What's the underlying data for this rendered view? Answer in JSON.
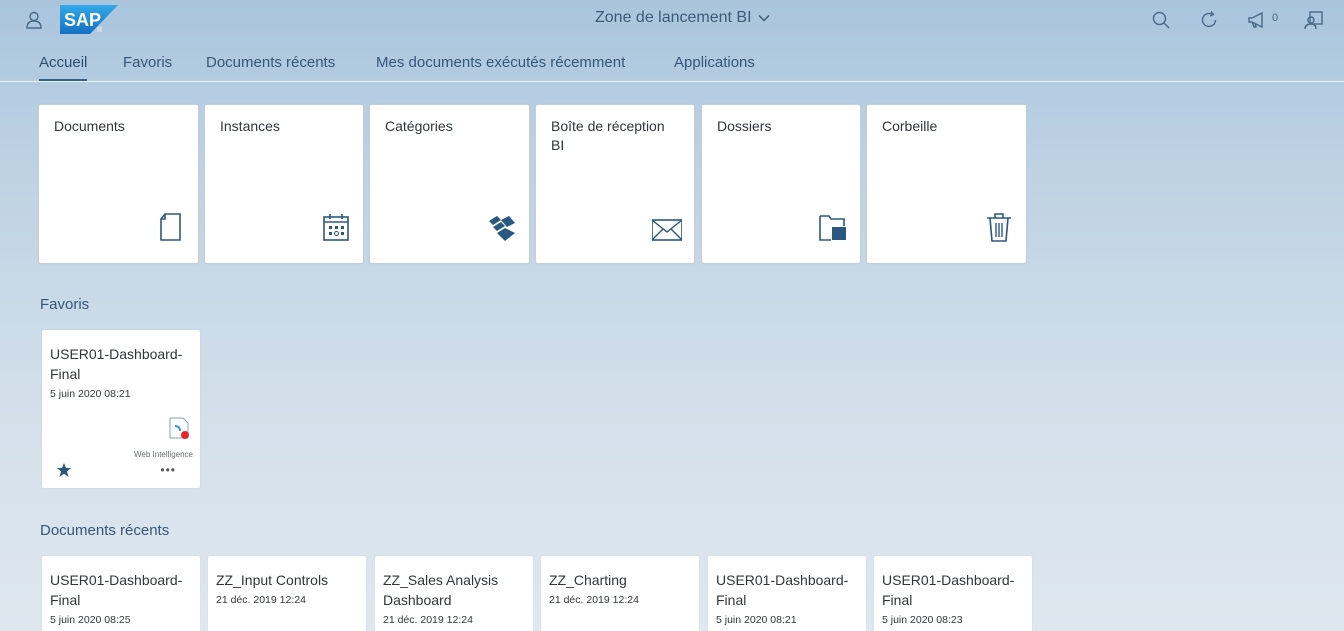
{
  "shell": {
    "title": "Zone de lancement BI",
    "notification_count": "0",
    "logo_text": "SAP",
    "icons": {
      "user": "user-icon",
      "search": "search-icon",
      "refresh": "refresh-icon",
      "notifications": "megaphone-icon",
      "preferences": "user-settings-icon",
      "dropdown": "chevron-down-icon"
    }
  },
  "tabs": [
    {
      "label": "Accueil",
      "active": true
    },
    {
      "label": "Favoris"
    },
    {
      "label": "Documents récents"
    },
    {
      "label": "Mes documents exécutés récemment"
    },
    {
      "label": "Applications"
    }
  ],
  "tiles": [
    {
      "label": "Documents",
      "icon": "document-icon"
    },
    {
      "label": "Instances",
      "icon": "calendar-icon"
    },
    {
      "label": "Catégories",
      "icon": "categories-icon"
    },
    {
      "label": "Boîte de réception BI",
      "icon": "envelope-icon"
    },
    {
      "label": "Dossiers",
      "icon": "folder-icon"
    },
    {
      "label": "Corbeille",
      "icon": "trash-icon"
    }
  ],
  "favorites": {
    "title": "Favoris",
    "items": [
      {
        "title": "USER01-Dashboard-Final",
        "date": "5 juin 2020 08:21",
        "type_label": "Web Intelligence",
        "more": "•••"
      }
    ]
  },
  "recent": {
    "title": "Documents récents",
    "items": [
      {
        "title": "USER01-Dashboard-Final",
        "date": "5 juin 2020 08:25"
      },
      {
        "title": "ZZ_Input Controls",
        "date": "21 déc. 2019 12:24"
      },
      {
        "title": "ZZ_Sales Analysis Dashboard",
        "date": "21 déc. 2019 12:24"
      },
      {
        "title": "ZZ_Charting",
        "date": "21 déc. 2019 12:24"
      },
      {
        "title": "USER01-Dashboard-Final",
        "date": "5 juin 2020 08:21"
      },
      {
        "title": "USER01-Dashboard-Final",
        "date": "5 juin 2020 08:23"
      }
    ]
  },
  "colors": {
    "accent": "#346187",
    "sap_logo_blue": "#1b8ad7",
    "webi_red": "#e8252a"
  }
}
